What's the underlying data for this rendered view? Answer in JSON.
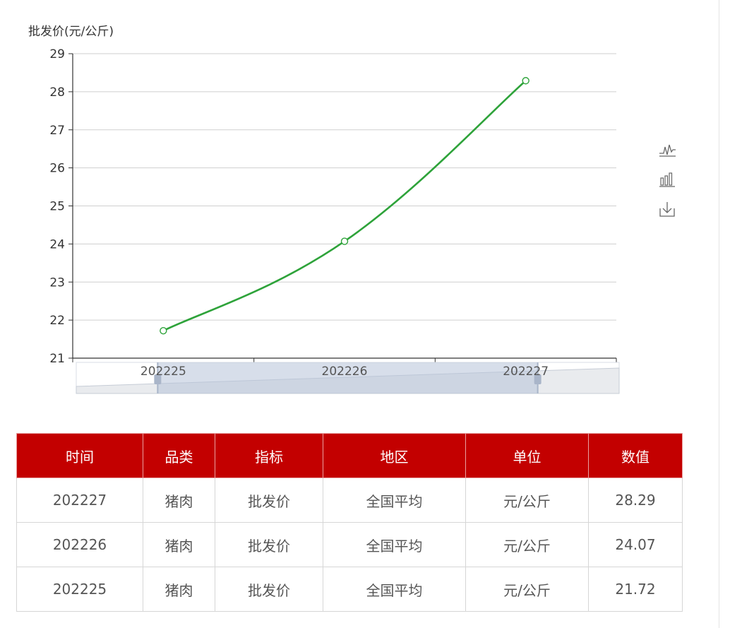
{
  "chart_data": {
    "type": "line",
    "ylabel": "批发价(元/公斤)",
    "categories": [
      "202225",
      "202226",
      "202227"
    ],
    "series": [
      {
        "values": [
          21.72,
          24.07,
          28.29
        ]
      }
    ],
    "ylim": [
      21,
      29
    ],
    "yticks": [
      21,
      22,
      23,
      24,
      25,
      26,
      27,
      28,
      29
    ],
    "grid": true,
    "smooth": true,
    "color": "#2ea33a",
    "datazoom": {
      "start_percent": 15,
      "end_percent": 85
    }
  },
  "toolbox": {
    "icons": [
      "line-chart-icon",
      "bar-chart-icon",
      "download-icon"
    ]
  },
  "table": {
    "headers": [
      "时间",
      "品类",
      "指标",
      "地区",
      "单位",
      "数值"
    ],
    "rows": [
      [
        "202227",
        "猪肉",
        "批发价",
        "全国平均",
        "元/公斤",
        "28.29"
      ],
      [
        "202226",
        "猪肉",
        "批发价",
        "全国平均",
        "元/公斤",
        "24.07"
      ],
      [
        "202225",
        "猪肉",
        "批发价",
        "全国平均",
        "元/公斤",
        "21.72"
      ]
    ]
  },
  "colors": {
    "header_bg": "#c30000",
    "line": "#2ea33a"
  }
}
